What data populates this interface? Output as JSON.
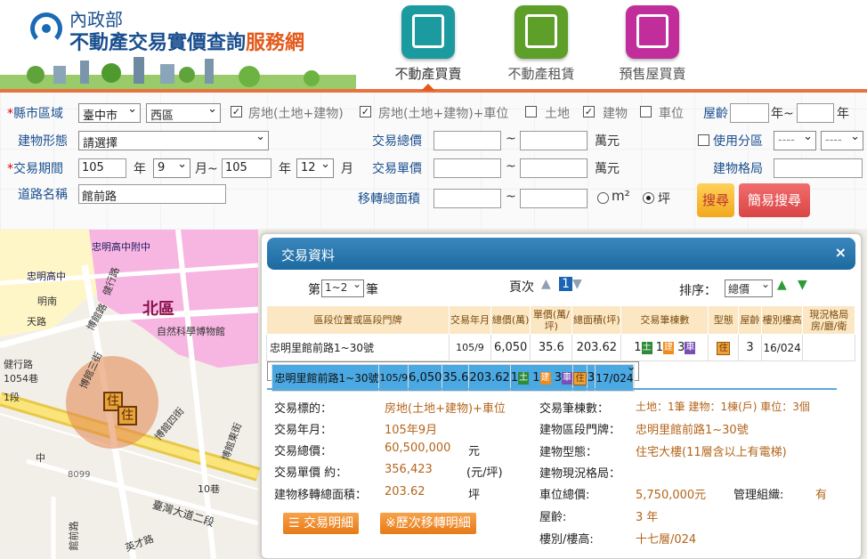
{
  "header": {
    "ministry": "內政部",
    "title_main": "不動產交易實價查詢",
    "title_service": "服務網",
    "tabs": [
      {
        "label": "不動產買賣",
        "color": "#1b9aa0",
        "active": true
      },
      {
        "label": "不動產租賃",
        "color": "#5e9f2a",
        "active": false
      },
      {
        "label": "預售屋買賣",
        "color": "#c12e9b",
        "active": false
      }
    ]
  },
  "filters": {
    "city_label": "縣市區域",
    "city": "臺中市",
    "district": "西區",
    "type_options": [
      {
        "label": "房地(土地+建物)",
        "checked": true
      },
      {
        "label": "房地(土地+建物)+車位",
        "checked": true
      },
      {
        "label": "土地",
        "checked": false
      },
      {
        "label": "建物",
        "checked": true
      },
      {
        "label": "車位",
        "checked": false
      }
    ],
    "age_label": "屋齡",
    "age_mid": "年~",
    "age_end": "年",
    "building_type_label": "建物形態",
    "building_type": "請選擇",
    "total_price_label": "交易總價",
    "unit_price_label": "交易單價",
    "wan": "萬元",
    "tilde": "~",
    "zoning_label": "使用分區",
    "zoning_1": "----",
    "zoning_2": "----",
    "period_label": "交易期間",
    "year_from": "105",
    "year_unit": "年",
    "month_from": "9",
    "month_unit_to": "月~",
    "year_to": "105",
    "month_to": "12",
    "month_unit": "月",
    "layout_label": "建物格局",
    "road_label": "道路名稱",
    "road": "館前路",
    "area_label": "移轉總面積",
    "unit_sqm": "m²",
    "unit_ping": "坪",
    "search_btn": "搜尋",
    "easy_btn": "簡易搜尋"
  },
  "map": {
    "labels": [
      "忠明高中附中",
      "忠明高中",
      "北區",
      "自然科學博物館",
      "健行路",
      "博館三街",
      "健行路 1054巷",
      "博館路",
      "1段",
      "博館四街",
      "博館東街",
      "臺灣大道二段",
      "10巷",
      "8099",
      "館前路",
      "英才路",
      "中",
      "天路",
      "明南"
    ],
    "marker": "住"
  },
  "panel": {
    "title": "交易資料",
    "close": "×",
    "page_prefix": "第",
    "page_value": "1~2",
    "page_suffix": "筆",
    "page_label": "頁次",
    "page_current": "1",
    "sort_label": "排序：",
    "sort_value": "總價",
    "columns": [
      "區段位置或區段門牌",
      "交易年月",
      "總價(萬)",
      "單價(萬/坪)",
      "總面積(坪)",
      "交易筆棟數",
      "型態",
      "屋齡",
      "樓別樓高",
      "現況格局房/廳/衛"
    ],
    "rows": [
      {
        "addr": "忠明里館前路1~30號",
        "ym": "105/9",
        "total": "6,050",
        "unit": "35.6",
        "area": "203.62",
        "n1": "1",
        "n2": "1",
        "n3": "3",
        "c1": "土",
        "c2": "建",
        "c3": "車",
        "type": "住",
        "age": "3",
        "floor": "16/024",
        "layout": "",
        "selected": false
      },
      {
        "addr": "忠明里館前路1~30號",
        "ym": "105/9",
        "total": "6,050",
        "unit": "35.6",
        "area": "203.62",
        "n1": "1",
        "n2": "1",
        "n3": "3",
        "c1": "土",
        "c2": "建",
        "c3": "車",
        "type": "住",
        "age": "3",
        "floor": "17/024",
        "layout": "",
        "selected": true
      }
    ],
    "detail": {
      "target_k": "交易標的：",
      "target_v": "房地(土地+建物)+車位",
      "ym_k": "交易年月：",
      "ym_v": "105年9月",
      "total_k": "交易總價：",
      "total_v": "60,500,000",
      "total_u": "元",
      "unit_k": "交易單價 約：",
      "unit_v": "356,423",
      "unit_u": "(元/坪)",
      "area_k": "建物移轉總面積：",
      "area_v": "203.62",
      "area_u": "坪",
      "count_k": "交易筆棟數：",
      "count_v": "土地：1筆 建物：1棟(戶) 車位：3個",
      "addr_k": "建物區段門牌：",
      "addr_v": "忠明里館前路1~30號",
      "btype_k": "建物型態：",
      "btype_v": "住宅大樓(11層含以上有電梯)",
      "layout_k": "建物現況格局：",
      "layout_v": "",
      "park_k": "車位總價:",
      "park_v": "5,750,000元",
      "mgmt_k": "管理組織:",
      "mgmt_v": "有",
      "age_k": "屋齡:",
      "age_v": "3 年",
      "floor_k": "樓別/樓高:",
      "floor_v": "十七層/024",
      "btn_detail": "交易明細",
      "btn_history": "※歷次移轉明細"
    }
  }
}
